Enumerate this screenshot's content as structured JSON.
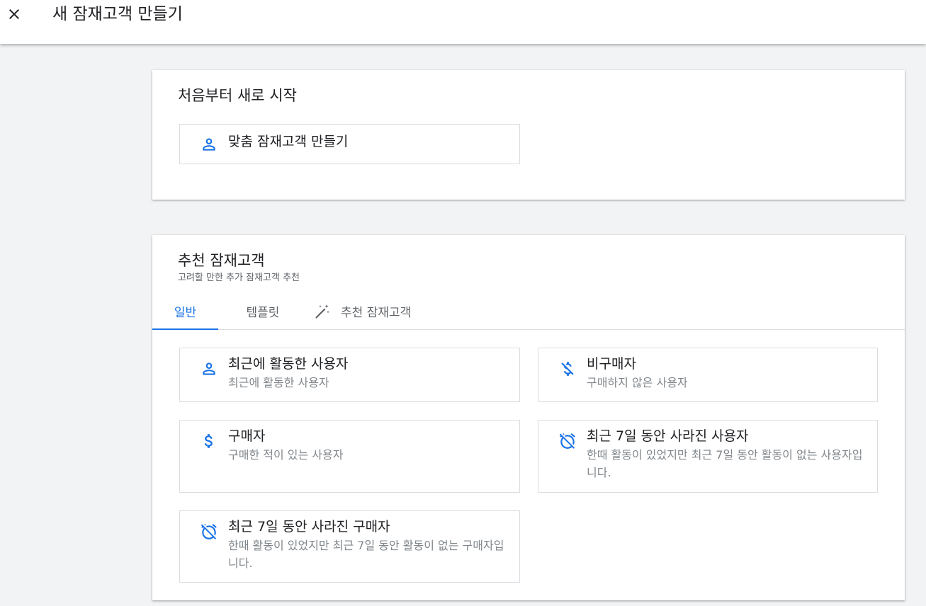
{
  "header": {
    "title": "새 잠재고객 만들기",
    "close_icon": "close-icon"
  },
  "scratch": {
    "title": "처음부터 새로 시작",
    "custom_option": {
      "icon": "person-icon",
      "title": "맞춤 잠재고객 만들기"
    }
  },
  "suggested": {
    "title": "추천 잠재고객",
    "subtitle": "고려할 만한 추가 잠재고객 추천",
    "tabs": [
      {
        "label": "일반",
        "active": true
      },
      {
        "label": "템플릿",
        "active": false
      },
      {
        "label": "추천 잠재고객",
        "active": false,
        "icon": "magic-wand-icon"
      }
    ],
    "options": [
      {
        "icon": "person-icon",
        "title": "최근에 활동한 사용자",
        "description": "최근에 활동한 사용자"
      },
      {
        "icon": "no-money-icon",
        "title": "비구매자",
        "description": "구매하지 않은 사용자"
      },
      {
        "icon": "dollar-icon",
        "title": "구매자",
        "description": "구매한 적이 있는 사용자"
      },
      {
        "icon": "alarm-off-icon",
        "title": "최근 7일 동안 사라진 사용자",
        "description": "한때 활동이 있었지만 최근 7일 동안 활동이 없는 사용자입니다."
      },
      {
        "icon": "alarm-off-icon",
        "title": "최근 7일 동안 사라진 구매자",
        "description": "한때 활동이 있었지만 최근 7일 동안 활동이 없는 구매자입니다."
      }
    ]
  },
  "colors": {
    "accent": "#1a73e8",
    "background": "#f1f3f4",
    "text_primary": "#202124",
    "text_secondary": "#80868b"
  }
}
